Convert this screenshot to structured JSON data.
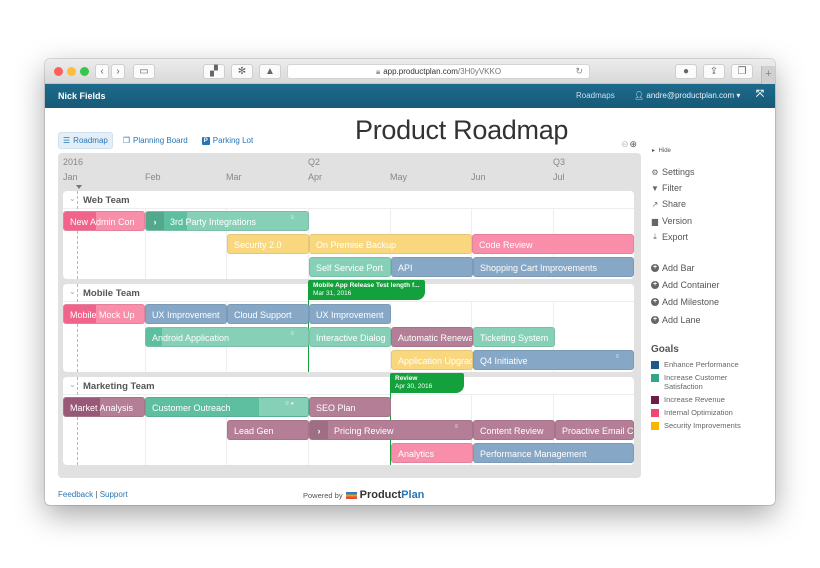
{
  "browser": {
    "url_domain": "app.productplan.com",
    "url_path": "/3H0yVKKO"
  },
  "appbar": {
    "user_name": "Nick Fields",
    "roadmaps_link": "Roadmaps",
    "account_email": "andre@productplan.com"
  },
  "tabs": [
    {
      "label": "Roadmap",
      "active": true
    },
    {
      "label": "Planning Board",
      "active": false
    },
    {
      "label": "Parking Lot",
      "active": false
    }
  ],
  "page_title": "Product Roadmap",
  "timeline": {
    "year": "2016",
    "quarters": [
      "Q2",
      "Q3"
    ],
    "months": [
      "Jan",
      "Feb",
      "Mar",
      "Apr",
      "May",
      "Jun",
      "Jul"
    ]
  },
  "lanes": [
    {
      "name": "Web Team",
      "bars": [
        {
          "label": "New Admin Con",
          "color": "#f0638a"
        },
        {
          "label": "3rd Party Integrations",
          "color": "#86d0b8",
          "container": true
        },
        {
          "label": "Security 2.0",
          "color": "#f8d77e"
        },
        {
          "label": "On Premise Backup",
          "color": "#f8d77e"
        },
        {
          "label": "Code Review",
          "color": "#f88ea9"
        },
        {
          "label": "Self Service Port",
          "color": "#86d0b8"
        },
        {
          "label": "API",
          "color": "#87a7c6"
        },
        {
          "label": "Shopping Cart Improvements",
          "color": "#87a7c6"
        }
      ]
    },
    {
      "name": "Mobile Team",
      "milestone": {
        "title": "Mobile App Release Test length f...",
        "date": "Mar 31, 2016"
      },
      "bars": [
        {
          "label": "Mobile Mock Up",
          "color": "#f0638a"
        },
        {
          "label": "UX Improvement",
          "color": "#87a7c6"
        },
        {
          "label": "Cloud Support",
          "color": "#87a7c6"
        },
        {
          "label": "UX Improvement",
          "color": "#87a7c6"
        },
        {
          "label": "Android Application",
          "color": "#86d0b8"
        },
        {
          "label": "Interactive Dialog",
          "color": "#86d0b8"
        },
        {
          "label": "Automatic Renewal",
          "color": "#b47e97"
        },
        {
          "label": "Ticketing System",
          "color": "#86d0b8"
        },
        {
          "label": "Application Upgrade",
          "color": "#f8d77e"
        },
        {
          "label": "Q4 Initiative",
          "color": "#87a7c6"
        }
      ]
    },
    {
      "name": "Marketing Team",
      "milestone": {
        "title": "Review",
        "date": "Apr 30, 2016"
      },
      "bars": [
        {
          "label": "Market Analysis",
          "color": "#b47e97"
        },
        {
          "label": "Customer Outreach",
          "color": "#5ebfa0"
        },
        {
          "label": "SEO Plan",
          "color": "#b47e97"
        },
        {
          "label": "Lead Gen",
          "color": "#b47e97"
        },
        {
          "label": "Pricing Review",
          "color": "#b47e97",
          "container": true
        },
        {
          "label": "Content Review",
          "color": "#b47e97"
        },
        {
          "label": "Proactive Email Campaign",
          "color": "#b47e97"
        },
        {
          "label": "Analytics",
          "color": "#f88ea9"
        },
        {
          "label": "Performance Management",
          "color": "#87a7c6"
        }
      ]
    }
  ],
  "sidebar": {
    "hide_label": "Hide",
    "actions": [
      {
        "label": "Settings",
        "icon": "gear-icon"
      },
      {
        "label": "Filter",
        "icon": "filter-icon"
      },
      {
        "label": "Share",
        "icon": "share-icon"
      },
      {
        "label": "Version",
        "icon": "archive-icon"
      },
      {
        "label": "Export",
        "icon": "download-icon"
      }
    ],
    "add_actions": [
      {
        "label": "Add Bar"
      },
      {
        "label": "Add Container"
      },
      {
        "label": "Add Milestone"
      },
      {
        "label": "Add Lane"
      }
    ],
    "goals_heading": "Goals",
    "goals": [
      {
        "label": "Enhance Performance",
        "color": "#1f5a8a"
      },
      {
        "label": "Increase Customer Satisfaction",
        "color": "#2fa888"
      },
      {
        "label": "Increase Revenue",
        "color": "#6e1d48"
      },
      {
        "label": "Internal Optimization",
        "color": "#f0457a"
      },
      {
        "label": "Security Improvements",
        "color": "#f7b500"
      }
    ]
  },
  "footer": {
    "feedback": "Feedback",
    "separator": "|",
    "support": "Support",
    "powered_by": "Powered by",
    "brand_a": "Product",
    "brand_b": "Plan"
  }
}
